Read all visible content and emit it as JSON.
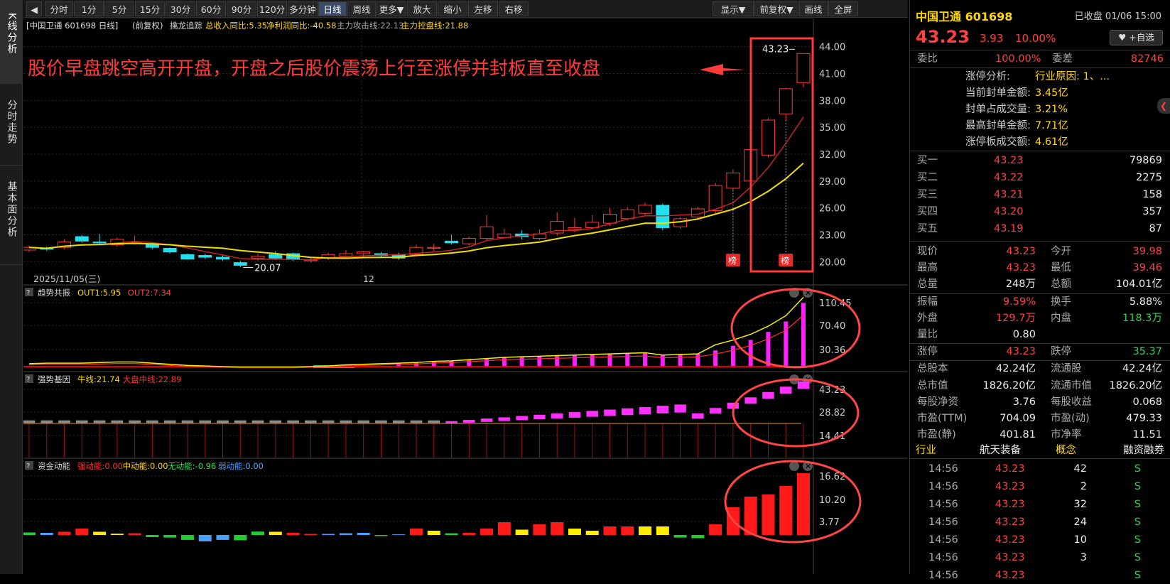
{
  "side_tabs": [
    "K线分析",
    "分时走势",
    "基本面分析"
  ],
  "toolbar": {
    "left": [
      "分时",
      "1分",
      "5分",
      "15分",
      "30分",
      "60分",
      "90分",
      "120分",
      "多分钟",
      "日线",
      "周线",
      "更多▼",
      "放大",
      "缩小",
      "左移",
      "右移"
    ],
    "active": "日线",
    "right": [
      "显示▼",
      "前复权▼",
      "画线",
      "全屏"
    ]
  },
  "chart_header": {
    "stock": "[中国卫通 601698 日线]",
    "adj": "(前复权)",
    "indicator": "擒龙追踪",
    "rev": "总收入同比:5.35",
    "profit": "净利润同比:-40.58",
    "attack": "主力攻击线:22.13",
    "control": "主力控盘线:21.88"
  },
  "annotation": "股价早盘跳空高开开盘，开盘之后股价震荡上行至涨停并封板直至收盘",
  "price_axis": [
    "44.00",
    "41.00",
    "38.00",
    "35.00",
    "32.00",
    "29.00",
    "26.00",
    "23.00",
    "20.00"
  ],
  "price_labels": {
    "high": "43.23",
    "low": "20.07",
    "bang": "榜"
  },
  "date_axis": {
    "start": "2025/11/05(三)",
    "mid": "12"
  },
  "sub1": {
    "name": "趋势共振",
    "l1": "OUT1:5.95",
    "l2": "OUT2:7.34",
    "axis": [
      "110.45",
      "70.40",
      "30.36"
    ]
  },
  "sub2": {
    "name": "强势基因",
    "l1": "牛线:21.74",
    "l2": "大盘中线:22.89",
    "axis": [
      "43.23",
      "28.82",
      "14.41"
    ]
  },
  "sub3": {
    "name": "资金动能",
    "l1": "强动能:0.00",
    "l2": "中动能:0.00",
    "l3": "无动能:-0.96",
    "l4": "弱动能:0.00",
    "axis": [
      "16.62",
      "10.20",
      "3.77"
    ]
  },
  "quote": {
    "name": "中国卫通",
    "code": "601698",
    "status": "已收盘 01/06 15:00",
    "price": "43.23",
    "change": "3.93",
    "pct": "10.00%",
    "watch": "+自选",
    "weibi_label": "委比",
    "weibi": "100.00%",
    "weicha_label": "委差",
    "weicha": "82746",
    "limit_info": [
      {
        "k": "涨停分析:",
        "v": "行业原因: 1、..."
      },
      {
        "k": "当前封单金额:",
        "v": "3.45亿"
      },
      {
        "k": "封单占成交量:",
        "v": "3.21%"
      },
      {
        "k": "最高封单金额:",
        "v": "7.71亿"
      },
      {
        "k": "涨停板成交额:",
        "v": "4.61亿"
      }
    ],
    "bids": [
      {
        "k": "买一",
        "p": "43.23",
        "v": "79869"
      },
      {
        "k": "买二",
        "p": "43.22",
        "v": "2275"
      },
      {
        "k": "买三",
        "p": "43.21",
        "v": "158"
      },
      {
        "k": "买四",
        "p": "43.20",
        "v": "357"
      },
      {
        "k": "买五",
        "p": "43.19",
        "v": "87"
      }
    ],
    "stats": [
      {
        "k1": "现价",
        "v1": "43.23",
        "c1": "red",
        "k2": "今开",
        "v2": "39.98",
        "c2": "red"
      },
      {
        "k1": "最高",
        "v1": "43.23",
        "c1": "red",
        "k2": "最低",
        "v2": "39.46",
        "c2": "red"
      },
      {
        "k1": "总量",
        "v1": "248万",
        "c1": "white",
        "k2": "总额",
        "v2": "104.01亿",
        "c2": "white"
      },
      {
        "k1": "振幅",
        "v1": "9.59%",
        "c1": "red",
        "k2": "换手",
        "v2": "5.88%",
        "c2": "white"
      },
      {
        "k1": "外盘",
        "v1": "129.7万",
        "c1": "red",
        "k2": "内盘",
        "v2": "118.3万",
        "c2": "green"
      },
      {
        "k1": "量比",
        "v1": "0.80",
        "c1": "white",
        "k2": "",
        "v2": "",
        "c2": "white"
      },
      {
        "k1": "涨停",
        "v1": "43.23",
        "c1": "red",
        "k2": "跌停",
        "v2": "35.37",
        "c2": "green"
      },
      {
        "k1": "总股本",
        "v1": "42.24亿",
        "c1": "white",
        "k2": "流通股",
        "v2": "42.24亿",
        "c2": "white"
      },
      {
        "k1": "总市值",
        "v1": "1826.20亿",
        "c1": "white",
        "k2": "流通市值",
        "v2": "1826.20亿",
        "c2": "white"
      },
      {
        "k1": "每股净资",
        "v1": "3.76",
        "c1": "white",
        "k2": "每股收益",
        "v2": "0.068",
        "c2": "white"
      },
      {
        "k1": "市盈(TTM)",
        "v1": "704.09",
        "c1": "white",
        "k2": "市盈(动)",
        "v2": "479.33",
        "c2": "white"
      },
      {
        "k1": "市盈(静)",
        "v1": "401.81",
        "c1": "white",
        "k2": "市净率",
        "v2": "11.51",
        "c2": "white"
      }
    ],
    "tabs": [
      "行业",
      "航天装备",
      "概念",
      "融资融券"
    ],
    "ticks": [
      {
        "t": "14:56",
        "p": "43.23",
        "v": "42",
        "d": "S"
      },
      {
        "t": "14:56",
        "p": "43.23",
        "v": "2",
        "d": "S"
      },
      {
        "t": "14:56",
        "p": "43.23",
        "v": "32",
        "d": "S"
      },
      {
        "t": "14:56",
        "p": "43.23",
        "v": "24",
        "d": "S"
      },
      {
        "t": "14:56",
        "p": "43.23",
        "v": "10",
        "d": "S"
      },
      {
        "t": "14:56",
        "p": "43.23",
        "v": "3",
        "d": "S"
      },
      {
        "t": "14:56",
        "p": "43.23",
        "v": "",
        "d": "S"
      }
    ]
  },
  "chart_data": {
    "type": "candlestick",
    "candles": [
      [
        21.3,
        21.6,
        21.1,
        21.8
      ],
      [
        21.5,
        21.4,
        21.2,
        21.7
      ],
      [
        21.6,
        22.2,
        21.4,
        22.5
      ],
      [
        22.8,
        22.3,
        22.1,
        23.0
      ],
      [
        22.2,
        22.1,
        21.9,
        23.1
      ],
      [
        21.9,
        22.5,
        21.7,
        22.7
      ],
      [
        22.1,
        22.2,
        21.9,
        22.9
      ],
      [
        22.0,
        21.6,
        21.4,
        22.1
      ],
      [
        21.5,
        21.1,
        20.9,
        21.6
      ],
      [
        20.8,
        20.3,
        20.2,
        20.9
      ],
      [
        20.7,
        20.5,
        20.3,
        20.9
      ],
      [
        20.5,
        20.3,
        20.1,
        20.7
      ],
      [
        19.9,
        19.6,
        19.4,
        20.1
      ],
      [
        20.4,
        20.6,
        20.1,
        20.9
      ],
      [
        20.8,
        20.4,
        20.2,
        21.2
      ],
      [
        20.9,
        20.3,
        20.1,
        21.0
      ],
      [
        20.1,
        20.2,
        19.9,
        20.5
      ],
      [
        20.4,
        20.8,
        20.2,
        21.0
      ],
      [
        20.6,
        20.9,
        20.4,
        21.3
      ],
      [
        20.9,
        21.1,
        20.5,
        21.2
      ],
      [
        20.9,
        20.7,
        20.4,
        21.1
      ],
      [
        20.8,
        20.4,
        20.2,
        21.0
      ],
      [
        20.8,
        21.6,
        20.6,
        21.9
      ],
      [
        21.5,
        21.6,
        21.2,
        22.0
      ],
      [
        22.3,
        22.1,
        21.9,
        23.0
      ],
      [
        22.0,
        22.6,
        21.8,
        22.8
      ],
      [
        22.6,
        23.9,
        22.4,
        25.2
      ],
      [
        22.7,
        23.1,
        22.6,
        23.7
      ],
      [
        23.1,
        22.8,
        22.5,
        23.5
      ],
      [
        22.6,
        23.1,
        22.4,
        23.6
      ],
      [
        23.2,
        24.5,
        22.9,
        25.5
      ],
      [
        23.6,
        23.8,
        23.3,
        24.9
      ],
      [
        23.8,
        24.4,
        23.6,
        25.2
      ],
      [
        24.3,
        25.3,
        24.0,
        26.0
      ],
      [
        24.8,
        25.8,
        24.6,
        26.1
      ],
      [
        25.4,
        26.3,
        25.2,
        26.6
      ],
      [
        26.3,
        23.8,
        23.5,
        26.5
      ],
      [
        23.9,
        24.8,
        23.7,
        25.0
      ],
      [
        25.0,
        25.9,
        24.8,
        26.1
      ],
      [
        25.7,
        28.5,
        25.4,
        28.8
      ],
      [
        28.2,
        29.9,
        28.0,
        30.3
      ],
      [
        29.0,
        32.5,
        28.7,
        32.9
      ],
      [
        31.9,
        35.8,
        31.6,
        36.0
      ],
      [
        36.5,
        39.3,
        35.8,
        39.4
      ],
      [
        39.98,
        43.23,
        39.46,
        43.23
      ]
    ],
    "price_range": [
      19.0,
      45.0
    ],
    "high_label": "43.23",
    "low_label": "20.07"
  }
}
